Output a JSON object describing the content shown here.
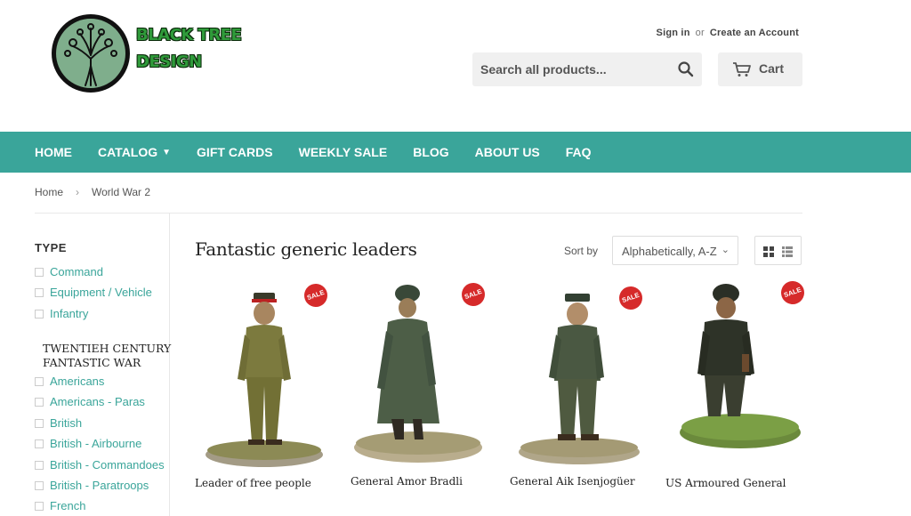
{
  "brand": {
    "line1": "BLACK TREE",
    "line2": "DESIGN"
  },
  "account": {
    "sign_in": "Sign in",
    "or": "or",
    "create": "Create an Account"
  },
  "search": {
    "placeholder": "Search all products..."
  },
  "cart": {
    "label": "Cart"
  },
  "nav": [
    "HOME",
    "CATALOG",
    "GIFT CARDS",
    "WEEKLY SALE",
    "BLOG",
    "ABOUT US",
    "FAQ"
  ],
  "breadcrumb": {
    "home": "Home",
    "sep": "›",
    "current": "World War 2"
  },
  "sidebar": {
    "type_heading": "TYPE",
    "type_items": [
      "Command",
      "Equipment / Vehicle",
      "Infantry"
    ],
    "war_heading": "TWENTIEH CENTURY FANTASTIC WAR",
    "war_items": [
      "Americans",
      "Americans - Paras",
      "British",
      "British - Airbourne",
      "British - Commandoes",
      "British - Paratroops",
      "French"
    ]
  },
  "collection": {
    "title": "Fantastic generic leaders"
  },
  "sort": {
    "label": "Sort by",
    "selected": "Alphabetically, A-Z"
  },
  "products": [
    {
      "name": "Leader of free people",
      "badge": "SALE"
    },
    {
      "name": "General Amor Bradli",
      "badge": "SALE"
    },
    {
      "name": "General Aik Isenjogüer",
      "badge": "SALE"
    },
    {
      "name": "US Armoured General",
      "badge": "SALE"
    }
  ],
  "colors": {
    "accent": "#3aa59a",
    "sale": "#d62a2a"
  }
}
